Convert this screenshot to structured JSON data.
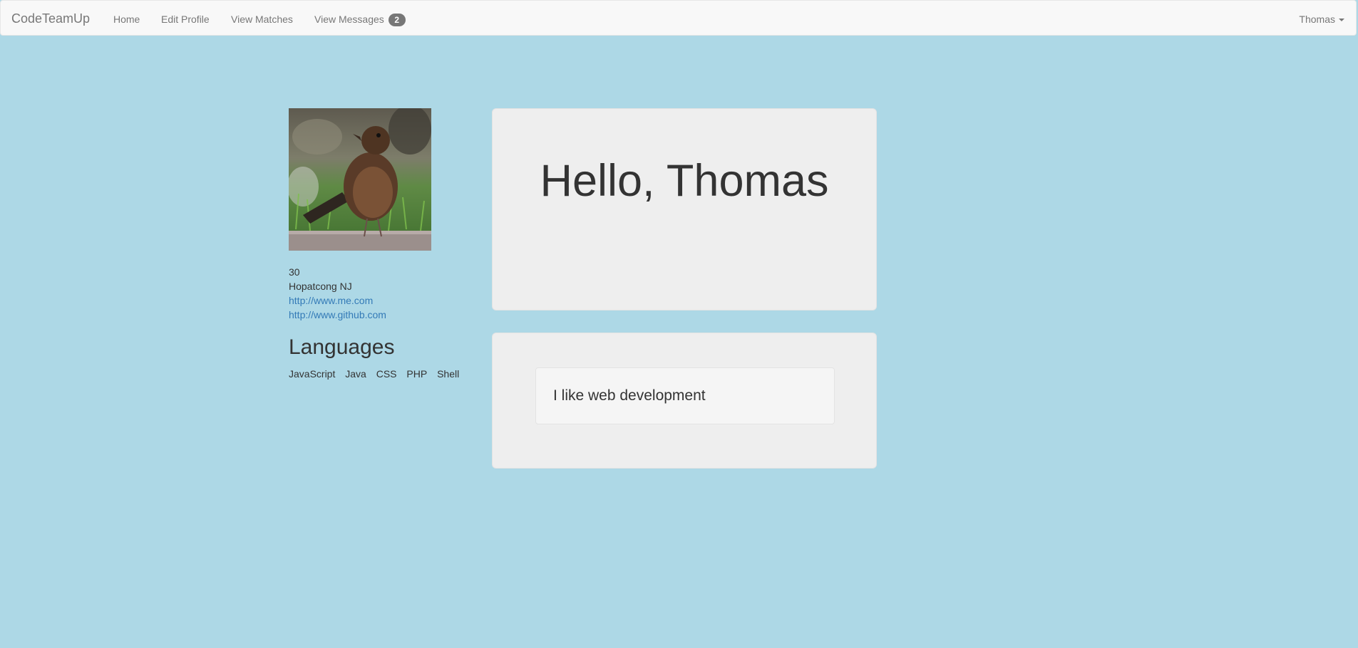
{
  "navbar": {
    "brand": "CodeTeamUp",
    "links": [
      {
        "label": "Home"
      },
      {
        "label": "Edit Profile"
      },
      {
        "label": "View Matches"
      },
      {
        "label": "View Messages",
        "badge": "2"
      }
    ],
    "user": "Thomas"
  },
  "profile": {
    "age": "30",
    "location": "Hopatcong NJ",
    "website": "http://www.me.com",
    "github": "http://www.github.com",
    "languages_title": "Languages",
    "languages": [
      "JavaScript",
      "Java",
      "CSS",
      "PHP",
      "Shell"
    ]
  },
  "main": {
    "greeting": "Hello, Thomas",
    "about": "I like web development"
  },
  "colors": {
    "background": "#add8e6",
    "navbar": "#f8f8f8",
    "panel": "#eeeeee",
    "link": "#337ab7"
  }
}
